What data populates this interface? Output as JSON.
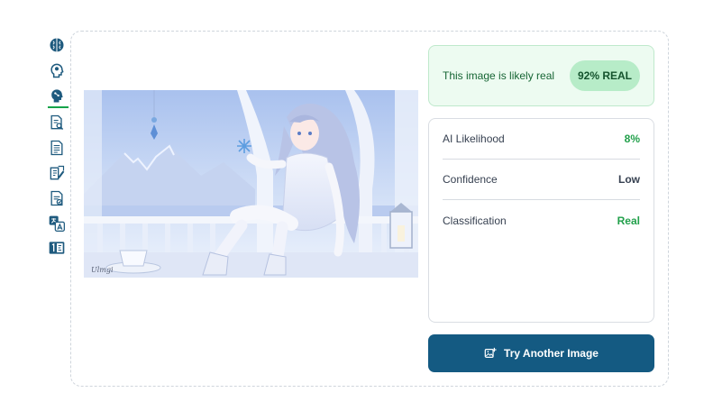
{
  "colors": {
    "accent": "#145a82",
    "success": "#22a04b",
    "success_bg": "#edfbf1",
    "badge_bg": "#b7ecc8",
    "rail_icon": "#1e5a7e"
  },
  "toolbar": {
    "items": [
      {
        "icon": "brain-icon"
      },
      {
        "icon": "head-profile-icon"
      },
      {
        "icon": "ai-head-icon",
        "active": true
      },
      {
        "icon": "document-search-icon"
      },
      {
        "icon": "document-text-icon"
      },
      {
        "icon": "edit-document-icon"
      },
      {
        "icon": "checklist-document-icon"
      },
      {
        "icon": "translate-icon"
      },
      {
        "icon": "number-converter-icon"
      }
    ]
  },
  "result": {
    "summary": "This image is likely real",
    "badge": "92% REAL"
  },
  "metrics": [
    {
      "label": "AI Likelihood",
      "value": "8%"
    },
    {
      "label": "Confidence",
      "value": "Low"
    },
    {
      "label": "Classification",
      "value": "Real"
    }
  ],
  "actions": {
    "try_again_label": "Try Another Image",
    "try_again_icon": "image-plus-icon"
  }
}
